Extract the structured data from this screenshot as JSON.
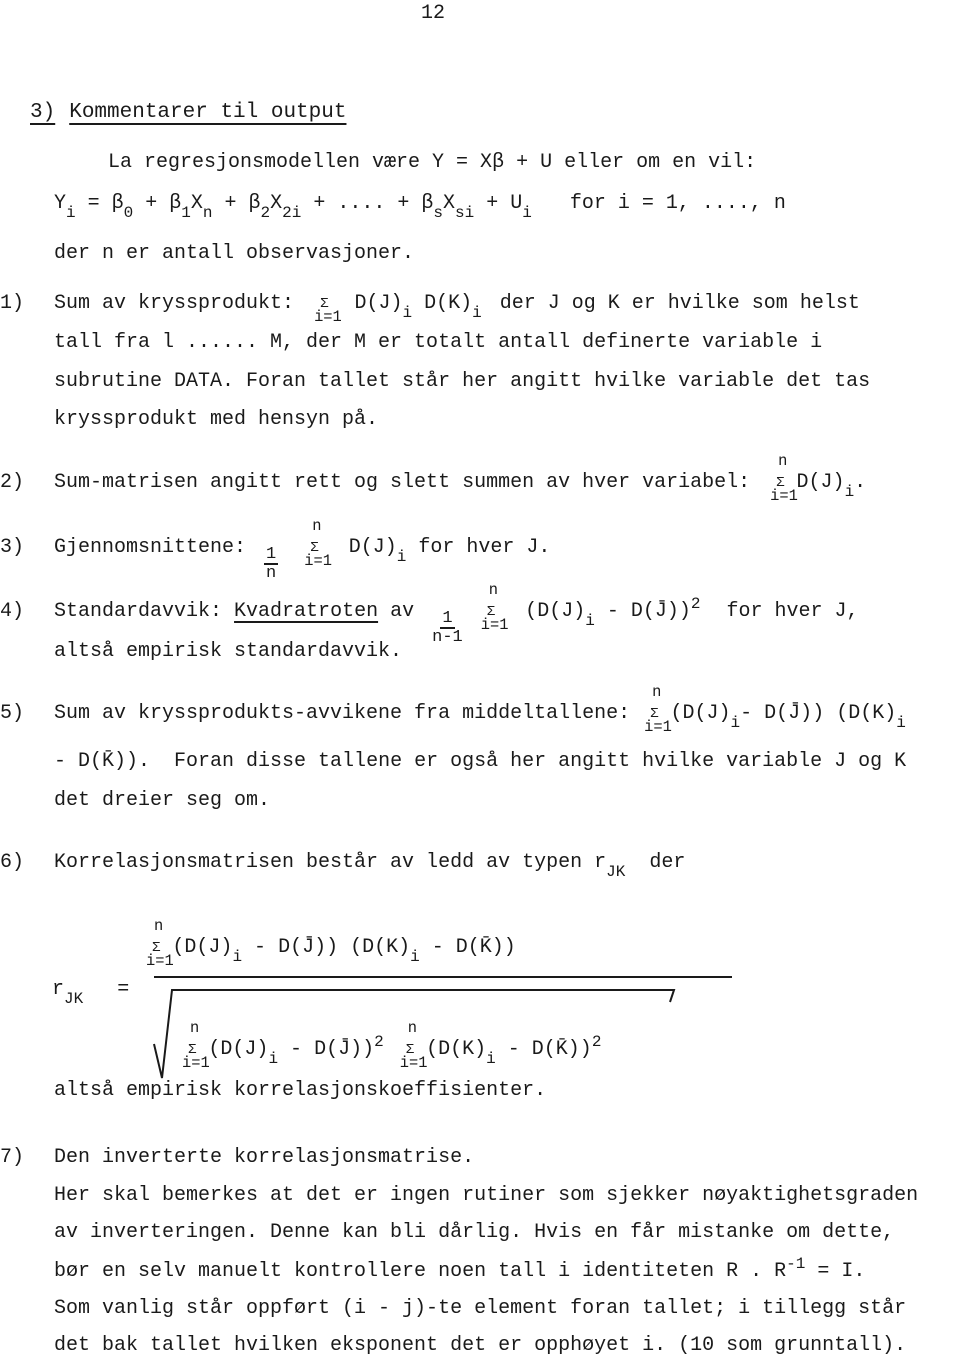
{
  "page_number": "12",
  "section": {
    "number": "3)",
    "title": "Kommentarer til output"
  },
  "intro": {
    "line1": "La regresjonsmodellen være Y = Xβ + U eller om en vil:",
    "model_eq": {
      "lhs": "Y",
      "lhs_sub": "i",
      "terms": [
        {
          "text": " = β",
          "sub": "0"
        },
        {
          "text": " + β",
          "sub": "1"
        },
        {
          "text": "X",
          "sub": "n"
        },
        {
          "text": " + β",
          "sub": "2"
        },
        {
          "text": "X",
          "sub": "2i"
        },
        {
          "text": " + .... + β",
          "sub": "s"
        },
        {
          "text": "X",
          "sub": "si"
        },
        {
          "text": " + U",
          "sub": "i"
        }
      ],
      "range": "for i = 1, ...., n"
    },
    "line3": "der n er antall observasjoner."
  },
  "items": [
    {
      "num": "1)",
      "lead": "Sum av kryssprodukt:",
      "formula_tail": "der J og K er hvilke som helst",
      "lines": [
        "tall fra l ...... M, der M er totalt antall definerte variable i",
        "subrutine DATA.  Foran tallet står her angitt hvilke variable det tas",
        "kryssprodukt med hensyn på."
      ]
    },
    {
      "num": "2)",
      "lead": "Sum-matrisen angitt rett og slett summen av hver variabel:"
    },
    {
      "num": "3)",
      "lead": "Gjennomsnittene:",
      "tail": "for hver J."
    },
    {
      "num": "4)",
      "lead": "Standardavvik:",
      "underlined": "Kvadratroten",
      "mid": "av",
      "tail": "for hver J,",
      "line2": "altså empirisk standardavvik."
    },
    {
      "num": "5)",
      "lead": "Sum av kryssprodukts-avvikene fra middeltallene:",
      "line2_start": "- D(K̄)).",
      "line2": "Foran disse tallene er også her angitt hvilke variable J og K",
      "line3": "det dreier seg om."
    },
    {
      "num": "6)",
      "lead": "Korrelasjonsmatrisen består av ledd av typen r",
      "lead_sub": "JK",
      "tail": "der",
      "after_formula": "altså empirisk korrelasjonskoeffisienter."
    },
    {
      "num": "7)",
      "lead": "Den inverterte korrelasjonsmatrise.",
      "lines": [
        "Her skal bemerkes at det er ingen rutiner som sjekker nøyaktighetsgraden",
        "av inverteringen.  Denne kan bli dårlig.  Hvis en får mistanke om dette,",
        "bør en selv manuelt kontrollere noen tall i identiteten R . R",
        "Som vanlig står oppført (i - j)-te element foran tallet; i tillegg står",
        "det bak tallet hvilken eksponent det er opphøyet i.  (10 som grunntall)."
      ],
      "identity_sup": "-1",
      "identity_tail": " = I."
    }
  ],
  "math": {
    "sigma": "Σ",
    "n": "n",
    "i1": "i=1",
    "sub_i": "i",
    "DJ": "D(J)",
    "DK": "D(K)",
    "DJbar": "D(J̄)",
    "DKbar": "D(K̄)",
    "one": "1",
    "n_minus_1": "n-1",
    "sq": "2",
    "minus": " - ",
    "dot": ".",
    "r": "r",
    "JK": "JK",
    "eq": "="
  }
}
